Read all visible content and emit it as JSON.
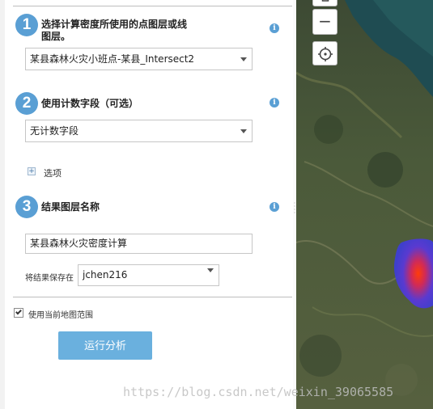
{
  "steps": [
    {
      "number": "1",
      "title_line1": "选择计算密度所使用的点图层或线",
      "title_line2": "图层。"
    },
    {
      "number": "2",
      "title": "使用计数字段（可选）"
    },
    {
      "number": "3",
      "title": "结果图层名称"
    }
  ],
  "info_icon": "i",
  "input_layer": {
    "value": "某县森林火灾小班点-某县_Intersect2"
  },
  "count_field": {
    "value": "无计数字段"
  },
  "options": {
    "expand_symbol": "+",
    "label": "选项"
  },
  "result_name": {
    "value": "某县森林火灾密度计算"
  },
  "save_in": {
    "label": "将结果保存在",
    "value": "jchen216"
  },
  "use_extent": {
    "label": "使用当前地图范围",
    "checked": true
  },
  "run_button": {
    "label": "运行分析"
  },
  "map_controls": {
    "zoom_out": "−"
  },
  "watermark": "https://blog.csdn.net/weixin_39065585",
  "colors": {
    "accent": "#5a9fd4",
    "button": "#6ab0de",
    "hotspot_core": "#ff3c0a",
    "hotspot_edge": "#3c3cdc"
  }
}
